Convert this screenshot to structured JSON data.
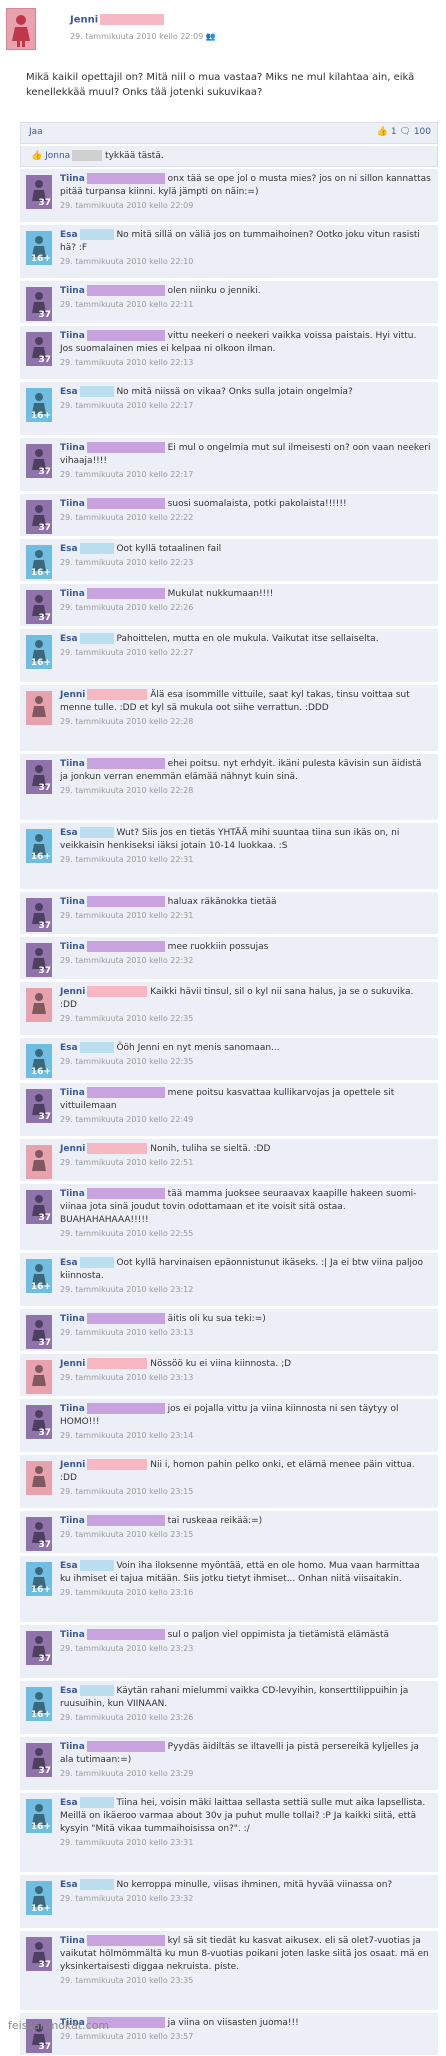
{
  "post": {
    "author": "Jenni",
    "meta": "29. tammikuuta 2010 kello 22:09",
    "text": "Mikä kaikil opettajil on? Mitä niil o mua vastaa? Miks ne mul kilahtaa ain, eikä kenellekkää muul? Onks tää jotenki sukuvikaa?"
  },
  "actions": {
    "share": "Jaa",
    "like_count": "1",
    "comment_count": "100"
  },
  "likes": {
    "name": "Jonna",
    "text": "tykkää tästä."
  },
  "comments": [
    {
      "name": "Tiina",
      "badge": "37",
      "color": "purple",
      "text": "onx tää se ope jol o musta mies? jos on ni sillon kannattas pitää turpansa kiinni. kylä jämpti on näin:=)",
      "date": "29. tammikuuta 2010 kello 22:09"
    },
    {
      "name": "Esa",
      "badge": "16+",
      "color": "blue",
      "text": "No mitä sillä on väliä jos on tummaihoinen? Ootko joku vitun rasisti hä? :F",
      "date": "29. tammikuuta 2010 kello 22:10"
    },
    {
      "name": "Tiina",
      "badge": "37",
      "color": "purple",
      "text": "olen niinku o jenniki.",
      "date": "29. tammikuuta 2010 kello 22:11"
    },
    {
      "name": "Tiina",
      "badge": "37",
      "color": "purple",
      "text": "vittu neekeri o neekeri vaikka voissa paistais. Hyi vittu. Jos suomalainen mies ei kelpaa ni olkoon ilman.",
      "date": "29. tammikuuta 2010 kello 22:13"
    },
    {
      "name": "Esa",
      "badge": "16+",
      "color": "blue",
      "text": "No mitä niissä on vikaa? Onks sulla jotain ongelmia?",
      "date": "29. tammikuuta 2010 kello 22:17"
    },
    {
      "name": "Tiina",
      "badge": "37",
      "color": "purple",
      "text": "Ei mul o ongelmia mut sul ilmeisesti on? oon vaan neekeri vihaaja!!!!",
      "date": "29. tammikuuta 2010 kello 22:17"
    },
    {
      "name": "Tiina",
      "badge": "37",
      "color": "purple",
      "text": "suosi suomalaista, potki pakolaista!!!!!!",
      "date": "29. tammikuuta 2010 kello 22:22"
    },
    {
      "name": "Esa",
      "badge": "16+",
      "color": "blue",
      "text": "Oot kyllä totaalinen fail",
      "date": "29. tammikuuta 2010 kello 22:23"
    },
    {
      "name": "Tiina",
      "badge": "37",
      "color": "purple",
      "text": "Mukulat nukkumaan!!!!",
      "date": "29. tammikuuta 2010 kello 22:26"
    },
    {
      "name": "Esa",
      "badge": "16+",
      "color": "blue",
      "text": "Pahoittelen, mutta en ole mukula. Vaikutat itse sellaiselta.",
      "date": "29. tammikuuta 2010 kello 22:27"
    },
    {
      "name": "Jenni",
      "badge": "",
      "color": "pink",
      "text": "Älä esa isommille vittuile, saat kyl takas, tinsu voittaa sut menne tulle. :DD et kyl sä mukula oot siihe verrattun. :DDD",
      "date": "29. tammikuuta 2010 kello 22:28"
    },
    {
      "name": "Tiina",
      "badge": "37",
      "color": "purple",
      "text": "ehei poitsu. nyt erhdyit. ikäni pulesta kävisin sun äidistä ja jonkun verran enemmän elämää nähnyt kuin sinä.",
      "date": "29. tammikuuta 2010 kello 22:28"
    },
    {
      "name": "Esa",
      "badge": "16+",
      "color": "blue",
      "text": "Wut? Siis jos en tietäs YHTÄÄ mihi suuntaa tiina sun ikäs on, ni veikkaisin henkiseksi iäksi jotain 10-14 luokkaa. :S",
      "date": "29. tammikuuta 2010 kello 22:31"
    },
    {
      "name": "Tiina",
      "badge": "37",
      "color": "purple",
      "text": "haluax räkänokka tietää",
      "date": "29. tammikuuta 2010 kello 22:31"
    },
    {
      "name": "Tiina",
      "badge": "37",
      "color": "purple",
      "text": "mee ruokkiin possujas",
      "date": "29. tammikuuta 2010 kello 22:32"
    },
    {
      "name": "Jenni",
      "badge": "",
      "color": "pink",
      "text": "Kaikki hävii tinsul, sil o kyl nii sana halus, ja se o sukuvika. :DD",
      "date": "29. tammikuuta 2010 kello 22:35"
    },
    {
      "name": "Esa",
      "badge": "16+",
      "color": "blue",
      "text": "Ööh Jenni en nyt menis sanomaan...",
      "date": "29. tammikuuta 2010 kello 22:35"
    },
    {
      "name": "Tiina",
      "badge": "37",
      "color": "purple",
      "text": "mene poitsu kasvattaa kullikarvojas ja opettele sit vittuilemaan",
      "date": "29. tammikuuta 2010 kello 22:49"
    },
    {
      "name": "Jenni",
      "badge": "",
      "color": "pink",
      "text": "Nonih, tuliha se sieltä. :DD",
      "date": "29. tammikuuta 2010 kello 22:51"
    },
    {
      "name": "Tiina",
      "badge": "37",
      "color": "purple",
      "text": "tää mamma juoksee seuraavax kaapille hakeen suomi-viinaa jota sinä joudut tovin odottamaan et ite voisit sitä ostaa. BUAHAHAHAAA!!!!!",
      "date": "29. tammikuuta 2010 kello 22:55"
    },
    {
      "name": "Esa",
      "badge": "16+",
      "color": "blue",
      "text": "Oot kyllä harvinaisen epäonnistunut ikäseks. :| Ja ei btw viina paljoo kiinnosta.",
      "date": "29. tammikuuta 2010 kello 23:12"
    },
    {
      "name": "Tiina",
      "badge": "37",
      "color": "purple",
      "text": "äitis oli ku sua teki:=)",
      "date": "29. tammikuuta 2010 kello 23:13"
    },
    {
      "name": "Jenni",
      "badge": "",
      "color": "pink",
      "text": "Nössöö ku ei viina kiinnosta. ;D",
      "date": "29. tammikuuta 2010 kello 23:13"
    },
    {
      "name": "Tiina",
      "badge": "37",
      "color": "purple",
      "text": "jos ei pojalla vittu ja viina kiinnosta ni sen täytyy ol HOMO!!!",
      "date": "29. tammikuuta 2010 kello 23:14"
    },
    {
      "name": "Jenni",
      "badge": "",
      "color": "pink",
      "text": "Nii i, homon pahin pelko onki, et elämä menee päin vittua. :DD",
      "date": "29. tammikuuta 2010 kello 23:15"
    },
    {
      "name": "Tiina",
      "badge": "37",
      "color": "purple",
      "text": "tai ruskeaa reikää:=)",
      "date": "29. tammikuuta 2010 kello 23:15"
    },
    {
      "name": "Esa",
      "badge": "16+",
      "color": "blue",
      "text": "Voin iha iloksenne myöntää, että en ole homo. Mua vaan harmittaa ku ihmiset ei tajua mitään. Siis jotku tietyt ihmiset... Onhan niitä viisaitakin.",
      "date": "29. tammikuuta 2010 kello 23:16"
    },
    {
      "name": "Tiina",
      "badge": "37",
      "color": "purple",
      "text": "sul o paljon viel oppimista ja tietämistä elämästä",
      "date": "29. tammikuuta 2010 kello 23:23"
    },
    {
      "name": "Esa",
      "badge": "16+",
      "color": "blue",
      "text": "Käytän rahani mielummi vaikka CD-levyihin, konserttilippuihin ja ruusuihin, kun VIINAAN.",
      "date": "29. tammikuuta 2010 kello 23:26"
    },
    {
      "name": "Tiina",
      "badge": "37",
      "color": "purple",
      "text": "Pyydäs äidiltäs se iltavelli ja pistä persereikä kyljelles ja ala tutimaan:=)",
      "date": "29. tammikuuta 2010 kello 23:29"
    },
    {
      "name": "Esa",
      "badge": "16+",
      "color": "blue",
      "text": "Tiina hei, voisin mäki laittaa sellasta settiä sulle mut aika lapsellista. Meillä on ikäeroo varmaa about 30v ja puhut mulle tollai? :P Ja kaikki siitä, että kysyin \"Mitä vikaa tummaihoisissa on?\". :/",
      "date": "29. tammikuuta 2010 kello 23:31"
    },
    {
      "name": "Esa",
      "badge": "16+",
      "color": "blue",
      "text": "No kerroppa minulle, viisas ihminen, mitä hyvää viinassa on?",
      "date": "29. tammikuuta 2010 kello 23:32"
    },
    {
      "name": "Tiina",
      "badge": "37",
      "color": "purple",
      "text": "kyl sä sit tiedät ku kasvat aikusex. eli sä olet7-vuotias ja vaikutat hölmömmältä ku mun 8-vuotias poikani joten laske siitä jos osaat. mä en yksinkertaisesti diggaa nekruista. piste.",
      "date": "29. tammikuuta 2010 kello 23:35"
    },
    {
      "name": "Tiina",
      "badge": "37",
      "color": "purple",
      "text": "ja viina on viisasten juoma!!!",
      "date": "29. tammikuuta 2010 kello 23:57"
    }
  ],
  "footer": {
    "site": "feissarimokat.com"
  },
  "colors": {
    "link": "#3b5998",
    "row_bg": "#eceff5",
    "purple": "#8f73ab",
    "blue": "#6fbde0",
    "pink": "#e8a2ad"
  }
}
